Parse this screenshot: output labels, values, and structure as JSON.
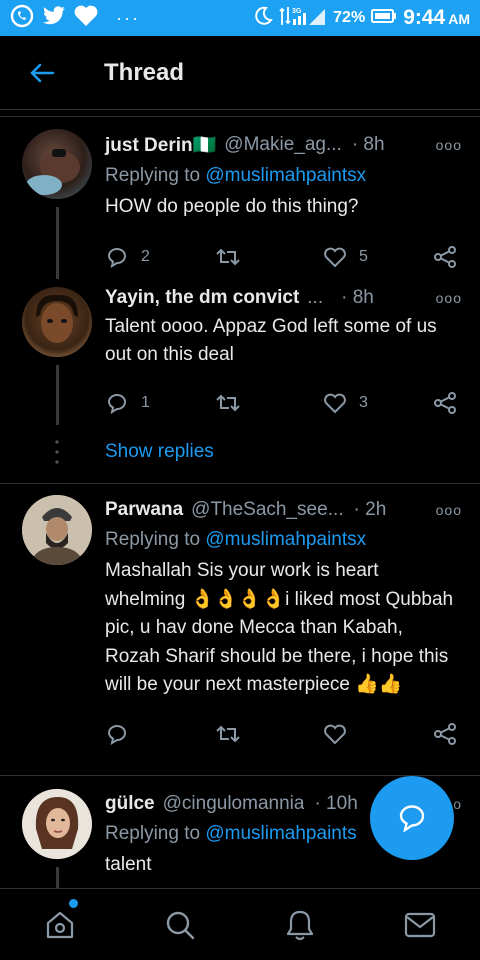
{
  "status_bar": {
    "battery": "72%",
    "time": "9:44",
    "ampm": "AM",
    "network": "3G"
  },
  "header": {
    "title": "Thread"
  },
  "tweets": [
    {
      "name": "just Derin🇳🇬",
      "handle": "@Makie_ag...",
      "time": "· 8h",
      "replying_label": "Replying to",
      "replying_to": "@muslimahpaintsx",
      "text": "HOW do people do this thing?",
      "replies": "2",
      "likes": "5"
    },
    {
      "name": "Yayin, the dm convict",
      "handle": "...",
      "time": "· 8h",
      "text": "Talent oooo. Appaz God left some of us out on this deal",
      "replies": "1",
      "likes": "3"
    },
    {
      "name": "Parwana",
      "handle": "@TheSach_see...",
      "time": "· 2h",
      "replying_label": "Replying to",
      "replying_to": "@muslimahpaintsx",
      "text": "Mashallah Sis your work is heart whelming 👌👌👌👌i liked most Qubbah pic, u hav done Mecca than Kabah, Rozah Sharif should be there, i hope this will be your next masterpiece 👍👍"
    },
    {
      "name": "gülce",
      "handle": "@cingulomannia",
      "time": "· 10h",
      "replying_label": "Replying to",
      "replying_to": "@muslimahpaints",
      "text": "talent"
    }
  ],
  "show_replies": "Show replies",
  "colors": {
    "accent": "#1d9bf0",
    "status_bar": "#1da1f2",
    "background": "#000000"
  },
  "icons": [
    "whatsapp-icon",
    "twitter-icon",
    "heart-icon",
    "moon-icon",
    "signal-icon",
    "battery-icon",
    "back-arrow-icon",
    "reply-icon",
    "retweet-icon",
    "like-icon",
    "share-icon",
    "home-icon",
    "search-icon",
    "notifications-icon",
    "messages-icon",
    "compose-reply-icon"
  ]
}
